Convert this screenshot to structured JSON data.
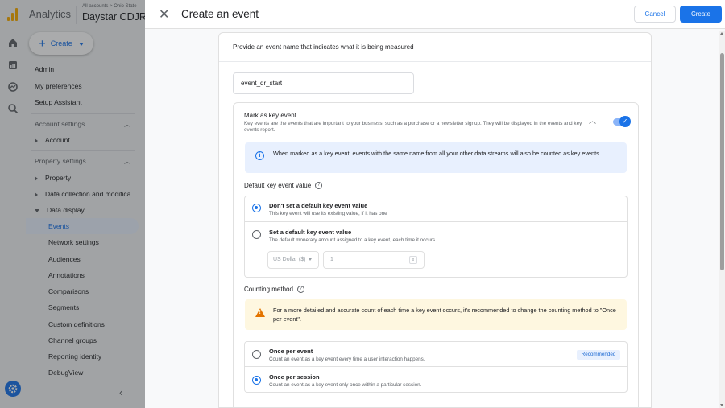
{
  "app": {
    "name": "Analytics",
    "breadcrumb": "All accounts > Ohio State",
    "property": "Daystar CDJR"
  },
  "nav": {
    "create_label": "Create",
    "items": [
      {
        "label": "Admin"
      },
      {
        "label": "My preferences"
      },
      {
        "label": "Setup Assistant"
      }
    ],
    "account_settings_label": "Account settings",
    "account_item": "Account",
    "property_settings_label": "Property settings",
    "property_items": [
      {
        "label": "Property"
      },
      {
        "label": "Data collection and modifica..."
      },
      {
        "label": "Data display"
      }
    ],
    "data_display_items": [
      {
        "label": "Events"
      },
      {
        "label": "Network settings"
      },
      {
        "label": "Audiences"
      },
      {
        "label": "Annotations"
      },
      {
        "label": "Comparisons"
      },
      {
        "label": "Segments"
      },
      {
        "label": "Custom definitions"
      },
      {
        "label": "Channel groups"
      },
      {
        "label": "Reporting identity"
      },
      {
        "label": "DebugView"
      }
    ]
  },
  "dialog": {
    "title": "Create an event",
    "cancel_label": "Cancel",
    "create_label": "Create",
    "card_heading": "Provide an event name that indicates what it is being measured",
    "event_name": "event_dr_start",
    "key_event": {
      "title": "Mark as key event",
      "description": "Key events are the events that are important to your business, such as a purchase or a newsletter signup. They will be displayed in the events and key events report.",
      "enabled": true,
      "info": "When marked as a key event, events with the same name from all your other data streams will also be counted as key events."
    },
    "default_value": {
      "label": "Default key event value",
      "options": [
        {
          "title": "Don't set a default key event value",
          "desc": "This key event will use its existing value, if it has one",
          "selected": true
        },
        {
          "title": "Set a default key event value",
          "desc": "The default monetary amount assigned to a key event, each time it occurs",
          "selected": false
        }
      ],
      "currency": "US Dollar ($)",
      "amount": "1"
    },
    "counting": {
      "label": "Counting method",
      "warning": "For a more detailed and accurate count of each time a key event occurs, it's recommended to change the counting method to \"Once per event\".",
      "options": [
        {
          "title": "Once per event",
          "desc": "Count an event as a key event every time a user interaction happens.",
          "badge": "Recommended",
          "selected": false
        },
        {
          "title": "Once per session",
          "desc": "Count an event as a key event only once within a particular session.",
          "selected": true
        }
      ]
    }
  },
  "colors": {
    "accent": "#1a73e8",
    "warning": "#e37400",
    "logo": "#f9ab00"
  }
}
